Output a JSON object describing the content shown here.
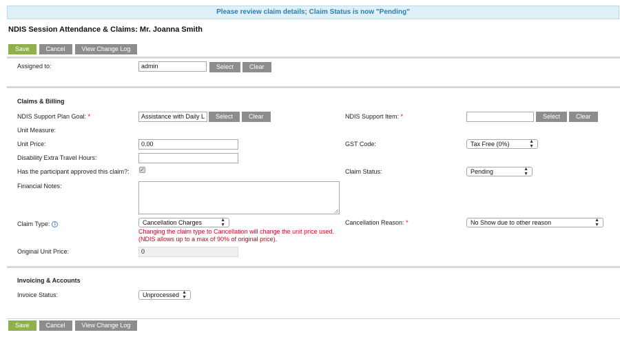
{
  "banner": {
    "text": "Please review claim details; Claim Status is now \"Pending\""
  },
  "page_title": "NDIS Session Attendance & Claims: Mr. Joanna Smith",
  "toolbar": {
    "save": "Save",
    "cancel": "Cancel",
    "change_log": "View Change Log"
  },
  "assigned": {
    "label": "Assigned to:",
    "value": "admin",
    "select": "Select",
    "clear": "Clear"
  },
  "claims": {
    "heading": "Claims & Billing",
    "goal_label": "NDIS Support Plan Goal:",
    "goal_value": "Assistance with Daily L",
    "goal_select": "Select",
    "goal_clear": "Clear",
    "support_item_label": "NDIS Support Item:",
    "support_item_value": "",
    "support_select": "Select",
    "support_clear": "Clear",
    "unit_measure_label": "Unit Measure:",
    "unit_price_label": "Unit Price:",
    "unit_price_value": "0.00",
    "gst_label": "GST Code:",
    "gst_value": "Tax Free (0%)",
    "travel_label": "Disability Extra Travel Hours:",
    "travel_value": "",
    "approved_label": "Has the participant approved this claim?:",
    "approved_checked": true,
    "status_label": "Claim Status:",
    "status_value": "Pending",
    "notes_label": "Financial Notes:",
    "notes_value": "",
    "type_label": "Claim Type:",
    "type_value": "Cancellation Charges",
    "type_warning_1": "Changing the claim type to Cancellation will change the unit price used.",
    "type_warning_2": "(NDIS allows up to a max of 90% of original price).",
    "reason_label": "Cancellation Reason:",
    "reason_value": "No Show due to other reason",
    "original_price_label": "Original Unit Price:",
    "original_price_value": "0",
    "required_mark": "*"
  },
  "invoicing": {
    "heading": "Invoicing & Accounts",
    "status_label": "Invoice Status:",
    "status_value": "Unprocessed"
  },
  "icons": {
    "info": "info-icon",
    "check": "check-icon",
    "select_arrows": "select-arrows-icon"
  },
  "colors": {
    "save_green": "#8fb04c",
    "button_grey": "#8d8d8d",
    "banner_bg": "#dff0f8",
    "banner_text": "#2a7fb4",
    "warning_red": "#d0021b"
  }
}
